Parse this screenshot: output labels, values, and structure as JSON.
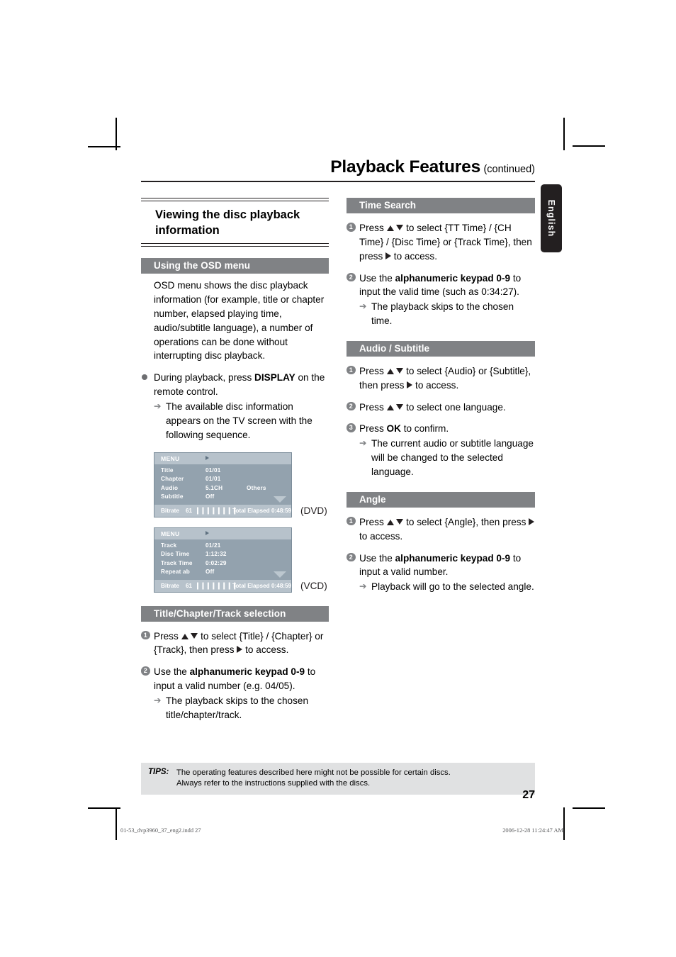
{
  "header": {
    "title": "Playback Features",
    "continued": "(continued)"
  },
  "language_tab": {
    "label": "English"
  },
  "left_column": {
    "section_title": "Viewing the disc playback information",
    "osd_section": {
      "bar_label": "Using the OSD menu",
      "paragraph": "OSD menu shows the disc playback information (for example, title or chapter number, elapsed playing time, audio/subtitle language), a number of operations can be done without interrupting disc playback.",
      "bullet": {
        "text_before": "During playback, press ",
        "bold": "DISPLAY",
        "text_after": " on the remote control.",
        "sub": "The available disc information appears on the TV screen with the following sequence."
      }
    },
    "osd_dvd": {
      "menu_label": "MENU",
      "rows": [
        {
          "label": "Title",
          "value": "01/01",
          "value2": ""
        },
        {
          "label": "Chapter",
          "value": "01/01",
          "value2": ""
        },
        {
          "label": "Audio",
          "value": "5.1CH",
          "value2": "Others"
        },
        {
          "label": "Subtitle",
          "value": "Off",
          "value2": ""
        }
      ],
      "footer": {
        "bitrate_label": "Bitrate",
        "bitrate_value": "61",
        "bitrate_bars": "❙❙❙❙❙❙❙❙",
        "elapsed_label": "Total Elapsed",
        "elapsed_value": "0:48:59"
      },
      "media_label": "(DVD)"
    },
    "osd_vcd": {
      "menu_label": "MENU",
      "rows": [
        {
          "label": "Track",
          "value": "01/21",
          "value2": ""
        },
        {
          "label": "Disc  Time",
          "value": "1:12:32",
          "value2": ""
        },
        {
          "label": "Track  Time",
          "value": "0:02:29",
          "value2": ""
        },
        {
          "label": "Repeat  ab",
          "value": "Off",
          "value2": ""
        }
      ],
      "footer": {
        "bitrate_label": "Bitrate",
        "bitrate_value": "61",
        "bitrate_bars": "❙❙❙❙❙❙❙❙",
        "elapsed_label": "Total Elapsed",
        "elapsed_value": "0:48:59"
      },
      "media_label": "(VCD)"
    },
    "title_chapter_track": {
      "bar_label": "Title/Chapter/Track selection",
      "step1_a": "Press ",
      "step1_b": " to select {Title} / {Chapter} or {Track}, then press ",
      "step1_c": " to access.",
      "step2_a": "Use the ",
      "step2_bold": "alphanumeric keypad 0-9",
      "step2_b": " to input a valid number (e.g. 04/05).",
      "step2_sub": "The playback skips to the chosen title/chapter/track."
    }
  },
  "right_column": {
    "time_search": {
      "bar_label": "Time Search",
      "step1_a": "Press ",
      "step1_b": " to select {TT Time} / {CH Time} / {Disc Time} or {Track Time}, then press ",
      "step1_c": " to access.",
      "step2_a": "Use the ",
      "step2_bold": "alphanumeric keypad 0-9",
      "step2_b": " to input the valid time (such as 0:34:27).",
      "step2_sub": "The playback skips to the chosen time."
    },
    "audio_subtitle": {
      "bar_label": "Audio / Subtitle",
      "step1_a": "Press ",
      "step1_b": " to select {Audio} or {Subtitle}, then press ",
      "step1_c": " to access.",
      "step2_a": "Press ",
      "step2_b": " to select one language.",
      "step3_a": "Press ",
      "step3_bold": "OK",
      "step3_b": " to confirm.",
      "step3_sub": "The current audio or subtitle language will be changed to the selected language."
    },
    "angle": {
      "bar_label": "Angle",
      "step1_a": "Press ",
      "step1_b": " to select {Angle}, then press ",
      "step1_c": " to access.",
      "step2_a": "Use the ",
      "step2_bold": "alphanumeric keypad 0-9",
      "step2_b": " to input a valid number.",
      "step2_sub": "Playback will go to the selected angle."
    }
  },
  "tips": {
    "label": "TIPS:",
    "line1": "The operating features described here might not be possible for certain discs.",
    "line2": "Always refer to the instructions supplied with the discs."
  },
  "page_number": "27",
  "production_footer": {
    "file": "01-53_dvp3960_37_eng2.indd   27",
    "timestamp": "2006-12-28   11:24:47 AM"
  },
  "step_numbers": {
    "one": "1",
    "two": "2",
    "three": "3"
  }
}
